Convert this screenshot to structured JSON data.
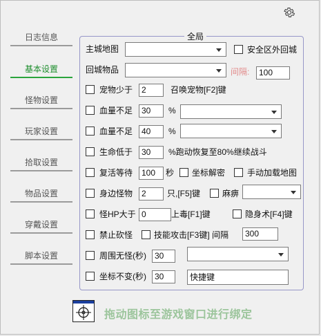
{
  "sidebar": {
    "items": [
      {
        "label": "日志信息",
        "active": false
      },
      {
        "label": "基本设置",
        "active": true
      },
      {
        "label": "怪物设置",
        "active": false
      },
      {
        "label": "玩家设置",
        "active": false
      },
      {
        "label": "拾取设置",
        "active": false
      },
      {
        "label": "物品设置",
        "active": false
      },
      {
        "label": "穿戴设置",
        "active": false
      },
      {
        "label": "脚本设置",
        "active": false
      }
    ]
  },
  "group": {
    "title": "全局",
    "main_map_label": "主城地图",
    "main_map_value": "",
    "safe_zone_label": "安全区外回城",
    "return_items_label": "回城物品",
    "return_items_value": "",
    "interval_label": "间隔:",
    "interval_value": "100",
    "pet_label": "宠物少于",
    "pet_value": "2",
    "pet_summon_label": "召唤宠物[F2]键",
    "hp1_label": "血量不足",
    "hp1_value": "30",
    "hp1_unit": "%",
    "hp2_label": "血量不足",
    "hp2_value": "40",
    "hp2_unit": "%",
    "life_label": "生命低于",
    "life_value": "30",
    "life_suffix": "%跑动恢复至80%继续战斗",
    "revive_label": "复活等待",
    "revive_value": "100",
    "revive_unit": "秒",
    "coord_decrypt_label": "坐标解密",
    "manual_load_label": "手动加载地图",
    "near_monster_label": "身边怪物",
    "near_monster_value": "2",
    "near_monster_suffix": "只,[F5]键",
    "paralysis_label": "麻痹",
    "monster_hp_label": "怪HP大于",
    "monster_hp_value": "0",
    "poison_label": "上毒[F1]键",
    "stealth_label": "隐身术[F4]键",
    "no_chop_label": "禁止砍怪",
    "skill_attack_label": "技能攻击[F3键] 间隔",
    "skill_interval_value": "300",
    "no_monster_label": "周围无怪(秒)",
    "no_monster_value": "30",
    "coord_still_label": "坐标不变(秒)",
    "coord_still_value": "30",
    "hotkey_value": "快捷键"
  },
  "footer": {
    "drag_text": "拖动图标至游戏窗口进行绑定"
  },
  "colors": {
    "active_tab": "#1e8e2e",
    "groupbox_border": "#9696c8",
    "interval_label": "#e28b8b",
    "drag_text": "#9cc59c"
  }
}
